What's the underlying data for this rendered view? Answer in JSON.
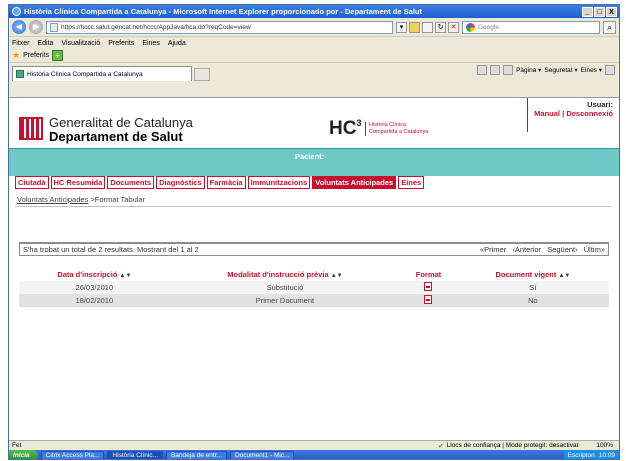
{
  "window": {
    "title": "Història Clínica Compartida a Catalunya - Microsoft Internet Explorer proporcionado por  - Departament de Salut",
    "buttons": [
      "_",
      "□",
      "X"
    ]
  },
  "browser": {
    "address": "https://hccc.salut.gencat.net/hccc/AppJava/hca.do?reqCode=view",
    "search_placeholder": "Google",
    "menu": [
      "Fitxer",
      "Edita",
      "Visualització",
      "Preferits",
      "Eines",
      "Ajuda"
    ],
    "favorites_label": "Preferits",
    "tab_title": "Història Clínica Compartida a Catalunya",
    "command_bar": [
      "Pàgina ▾",
      "Seguretat ▾",
      "Eines ▾"
    ]
  },
  "header": {
    "org_line1": "Generalitat de Catalunya",
    "org_line2": "Departament de Salut",
    "hc3": "HC",
    "hc3_sup": "3",
    "hc3_sub1": "Història Clínica",
    "hc3_sub2": "Compartida a Catalunya",
    "user_label": "Usuari:",
    "manual_link": "Manual",
    "separator": "|",
    "logout_link": "Desconnexió"
  },
  "patient_label": "Pacient:",
  "nav": [
    {
      "label": "Ciutadà",
      "active": false
    },
    {
      "label": "HC Resumida",
      "active": false
    },
    {
      "label": "Documents",
      "active": false
    },
    {
      "label": "Diagnòstics",
      "active": false
    },
    {
      "label": "Farmàcia",
      "active": false
    },
    {
      "label": "Immunitzacions",
      "active": false
    },
    {
      "label": "Voluntats Anticipades",
      "active": true
    },
    {
      "label": "Eines",
      "active": false
    }
  ],
  "breadcrumb": {
    "link": "Voluntats Anticipades",
    "sep": " >",
    "current": "Format Tabular"
  },
  "results": {
    "summary": "S'ha trobat un total de 2 resultats. Mostrant del 1 al 2",
    "first": "«Primer",
    "prev": "‹Anterior",
    "next": "Següent›",
    "last": "Últim»"
  },
  "table": {
    "headers": [
      "Data d'inscripció",
      "Modalitat d'instrucció prèvia",
      "Format",
      "Document vigent"
    ],
    "rows": [
      {
        "date": "26/03/2010",
        "modality": "Substitució",
        "format": "pdf-icon",
        "valid": "Sí"
      },
      {
        "date": "18/02/2010",
        "modality": "Primer Document",
        "format": "pdf-icon",
        "valid": "No"
      }
    ]
  },
  "statusbar": {
    "text": "Fet",
    "zone": "Llocs de confiança | Mode protegit: desactivat",
    "zoom": "100%"
  },
  "taskbar": {
    "start": "Inicia",
    "buttons": [
      "Citrix Access Pla...",
      "Història Clínic...",
      "Bandeja de entr...",
      "Document1 - Mic..."
    ],
    "active_index": 1,
    "desk_label": "Escriptori",
    "clock": "10:09"
  },
  "colors": {
    "accent": "#c8102e",
    "patient_bar": "#6ec8c6"
  }
}
